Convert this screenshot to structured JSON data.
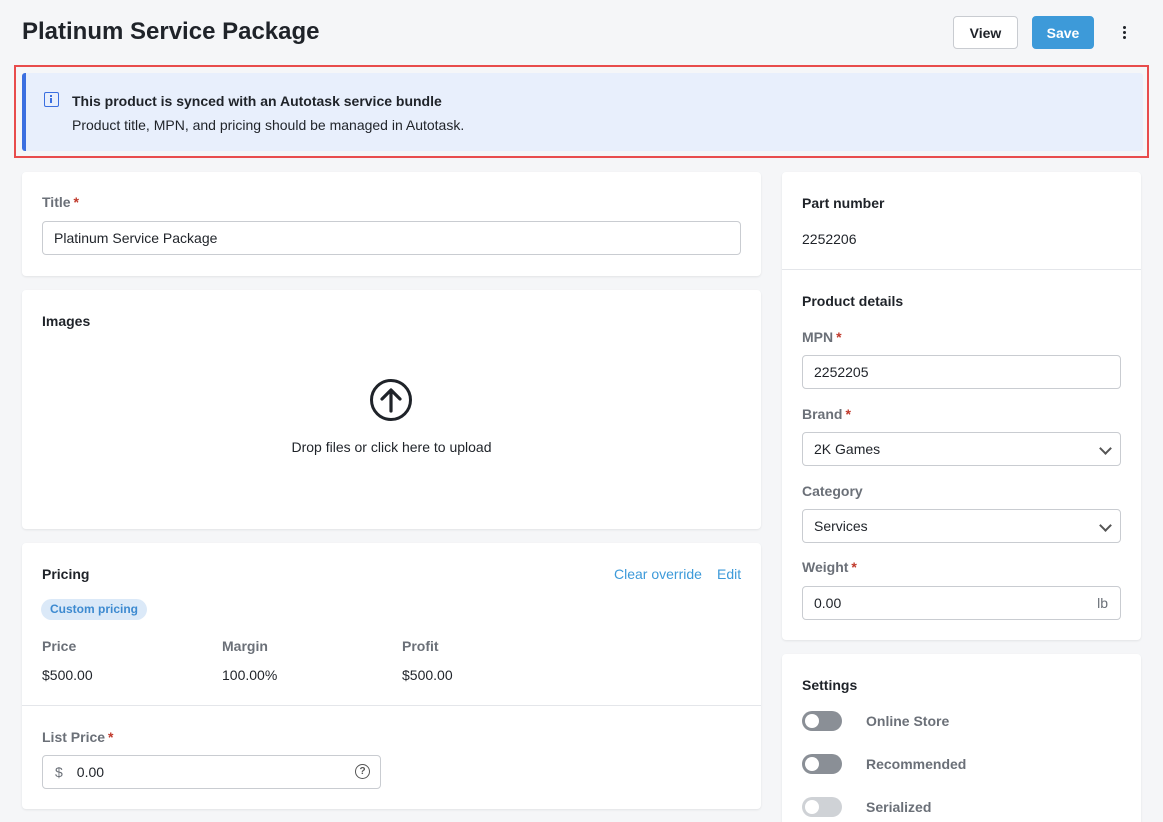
{
  "header": {
    "title": "Platinum Service Package",
    "view_label": "View",
    "save_label": "Save"
  },
  "banner": {
    "title": "This product is synced with an Autotask service bundle",
    "text": "Product title, MPN, and pricing should be managed in Autotask."
  },
  "title_card": {
    "label": "Title",
    "value": "Platinum Service Package"
  },
  "images_card": {
    "heading": "Images",
    "upload_text": "Drop files or click here to upload"
  },
  "pricing_card": {
    "heading": "Pricing",
    "clear_override": "Clear override",
    "edit": "Edit",
    "badge": "Custom pricing",
    "columns": [
      {
        "label": "Price",
        "value": "$500.00"
      },
      {
        "label": "Margin",
        "value": "100.00%"
      },
      {
        "label": "Profit",
        "value": "$500.00"
      }
    ],
    "list_price_label": "List Price",
    "currency_symbol": "$",
    "list_price_value": "0.00"
  },
  "part_card": {
    "heading": "Part number",
    "value": "2252206"
  },
  "details_card": {
    "heading": "Product details",
    "mpn_label": "MPN",
    "mpn_value": "2252205",
    "brand_label": "Brand",
    "brand_value": "2K Games",
    "category_label": "Category",
    "category_value": "Services",
    "weight_label": "Weight",
    "weight_value": "0.00",
    "weight_unit": "lb"
  },
  "settings_card": {
    "heading": "Settings",
    "toggles": [
      {
        "label": "Online Store",
        "on": false,
        "enabled": true
      },
      {
        "label": "Recommended",
        "on": false,
        "enabled": true
      },
      {
        "label": "Serialized",
        "on": false,
        "enabled": false
      }
    ]
  },
  "colors": {
    "primary": "#3d9ad9",
    "banner_bg": "#e8effc",
    "banner_accent": "#3b6fe0",
    "highlight": "#e84c4c",
    "required": "#c0392b"
  }
}
